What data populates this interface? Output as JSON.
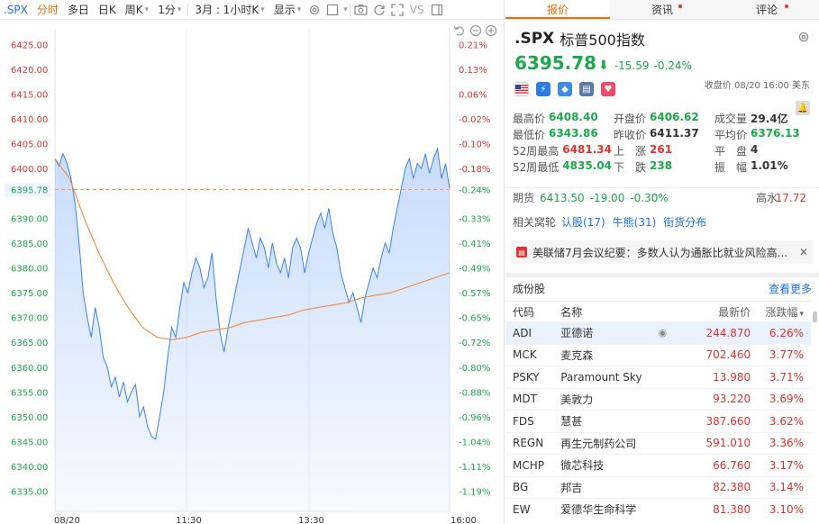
{
  "toolbar": {
    "symbol": ".SPX",
    "items": [
      "分时",
      "多日",
      "日K",
      "周K",
      "1分",
      "3月 : 1小时K",
      "显示"
    ],
    "vs_label": "VS"
  },
  "chart_data": {
    "type": "line",
    "yticks": [
      6425.0,
      6420.0,
      6415.0,
      6410.0,
      6405.0,
      6400.0,
      6395.78,
      6390.0,
      6385.0,
      6380.0,
      6375.0,
      6370.0,
      6365.0,
      6360.0,
      6355.0,
      6350.0,
      6345.0,
      6340.0,
      6335.0
    ],
    "ytick_labels": [
      "6425.00",
      "6420.00",
      "6415.00",
      "6410.00",
      "6405.00",
      "6400.00",
      "6395.78",
      "6390.00",
      "6385.00",
      "6380.00",
      "6375.00",
      "6370.00",
      "6365.00",
      "6360.00",
      "6355.00",
      "6350.00",
      "6345.00",
      "6340.00",
      "6335.00"
    ],
    "pct_labels": [
      "0.21%",
      "0.13%",
      "0.06%",
      "-0.02%",
      "-0.10%",
      "-0.18%",
      "-0.24%",
      "-0.33%",
      "-0.41%",
      "-0.49%",
      "-0.57%",
      "-0.65%",
      "-0.72%",
      "-0.80%",
      "-0.88%",
      "-0.96%",
      "-1.04%",
      "-1.11%",
      "-1.19%"
    ],
    "xlabels": [
      "08/20",
      "11:30",
      "13:30",
      "16:00"
    ],
    "ref_price": 6395.78,
    "price_series": [
      6402.0,
      6400.5,
      6403.0,
      6401.0,
      6398.0,
      6393.0,
      6385.0,
      6375.0,
      6370.0,
      6366.0,
      6372.0,
      6368.0,
      6362.0,
      6360.0,
      6356.0,
      6358.0,
      6354.0,
      6357.0,
      6353.0,
      6355.0,
      6356.5,
      6350.0,
      6352.0,
      6348.0,
      6346.0,
      6345.5,
      6350.0,
      6355.0,
      6362.0,
      6368.0,
      6366.0,
      6372.0,
      6377.0,
      6375.0,
      6379.0,
      6382.0,
      6380.0,
      6376.0,
      6378.0,
      6383.0,
      6374.0,
      6367.0,
      6363.0,
      6368.0,
      6372.0,
      6376.0,
      6380.0,
      6384.0,
      6388.0,
      6385.0,
      6382.0,
      6386.0,
      6384.0,
      6380.0,
      6385.0,
      6381.0,
      6379.0,
      6382.0,
      6378.0,
      6384.0,
      6386.0,
      6384.0,
      6379.0,
      6383.0,
      6386.0,
      6389.0,
      6391.0,
      6388.0,
      6392.0,
      6387.0,
      6384.0,
      6379.0,
      6376.0,
      6373.0,
      6375.0,
      6372.0,
      6369.0,
      6374.0,
      6377.0,
      6380.0,
      6378.0,
      6382.0,
      6385.0,
      6383.0,
      6388.0,
      6392.0,
      6396.0,
      6400.0,
      6402.0,
      6398.0,
      6401.0,
      6400.0,
      6403.0,
      6399.0,
      6402.0,
      6404.0,
      6398.0,
      6401.0,
      6396.0
    ],
    "avg_series": [
      6402.0,
      6398.0,
      6390.0,
      6383.0,
      6377.0,
      6372.0,
      6368.0,
      6366.0,
      6365.5,
      6366.0,
      6367.0,
      6367.5,
      6368.0,
      6369.0,
      6369.5,
      6370.0,
      6370.5,
      6371.5,
      6372.0,
      6372.5,
      6373.0,
      6374.0,
      6374.5,
      6375.0,
      6376.0,
      6377.0,
      6378.0,
      6379.0
    ],
    "price_color": "#3b82f6",
    "avg_color": "#f08a3c",
    "ref_line_color": "#f4a05a"
  },
  "side": {
    "tabs": [
      {
        "label": "报价",
        "active": true
      },
      {
        "label": "资讯",
        "dot": true
      },
      {
        "label": "评论",
        "dot": true
      }
    ],
    "symbol": ".SPX",
    "name": "标普500指数",
    "price": "6395.78",
    "change": "-15.59",
    "change_pct": "-0.24%",
    "close_note": "收盘价 08/20 16:00 美东",
    "stats": [
      [
        {
          "label": "最高价",
          "value": "6408.40",
          "color": "green"
        },
        {
          "label": "开盘价",
          "value": "6406.62",
          "color": "green"
        },
        {
          "label": "成交量",
          "value": "29.4亿",
          "color": "dark"
        }
      ],
      [
        {
          "label": "最低价",
          "value": "6343.86",
          "color": "green"
        },
        {
          "label": "昨收价",
          "value": "6411.37",
          "color": "dark"
        },
        {
          "label": "平均价",
          "value": "6376.13",
          "color": "green"
        }
      ],
      [
        {
          "label": "52周最高",
          "value": "6481.34",
          "color": "red"
        },
        {
          "label": "上　涨",
          "value": "261",
          "color": "red"
        },
        {
          "label": "平　盘",
          "value": "4",
          "color": "dark"
        }
      ],
      [
        {
          "label": "52周最低",
          "value": "4835.04",
          "color": "green"
        },
        {
          "label": "下　跌",
          "value": "238",
          "color": "green"
        },
        {
          "label": "振　幅",
          "value": "1.01%",
          "color": "dark"
        }
      ]
    ],
    "futures": {
      "label": "期货",
      "price": "6413.50",
      "change": "-19.00",
      "pct": "-0.30%",
      "high_label": "高水",
      "high_value": "17.72"
    },
    "related": {
      "label": "相关窝轮",
      "links": [
        "认股(17)",
        "牛熊(31)",
        "街货分布"
      ]
    },
    "news": {
      "text": "美联储7月会议纪要：多数人认为通胀比就业风险高..."
    },
    "constituents": {
      "title": "成份股",
      "more": "查看更多",
      "headers": [
        "代码",
        "名称",
        "最新价",
        "涨跌幅"
      ],
      "rows": [
        {
          "code": "ADI",
          "name": "亚德诺",
          "price": "244.870",
          "pct": "6.26%"
        },
        {
          "code": "MCK",
          "name": "麦克森",
          "price": "702.460",
          "pct": "3.77%"
        },
        {
          "code": "PSKY",
          "name": "Paramount Sky",
          "price": "13.980",
          "pct": "3.71%"
        },
        {
          "code": "MDT",
          "name": "美敦力",
          "price": "93.220",
          "pct": "3.69%"
        },
        {
          "code": "FDS",
          "name": "慧甚",
          "price": "387.660",
          "pct": "3.62%"
        },
        {
          "code": "REGN",
          "name": "再生元制药公司",
          "price": "591.010",
          "pct": "3.36%"
        },
        {
          "code": "MCHP",
          "name": "微芯科技",
          "price": "66.760",
          "pct": "3.17%"
        },
        {
          "code": "BG",
          "name": "邦吉",
          "price": "82.380",
          "pct": "3.14%"
        },
        {
          "code": "EW",
          "name": "爱德华生命科学",
          "price": "81.380",
          "pct": "3.10%"
        }
      ]
    }
  }
}
